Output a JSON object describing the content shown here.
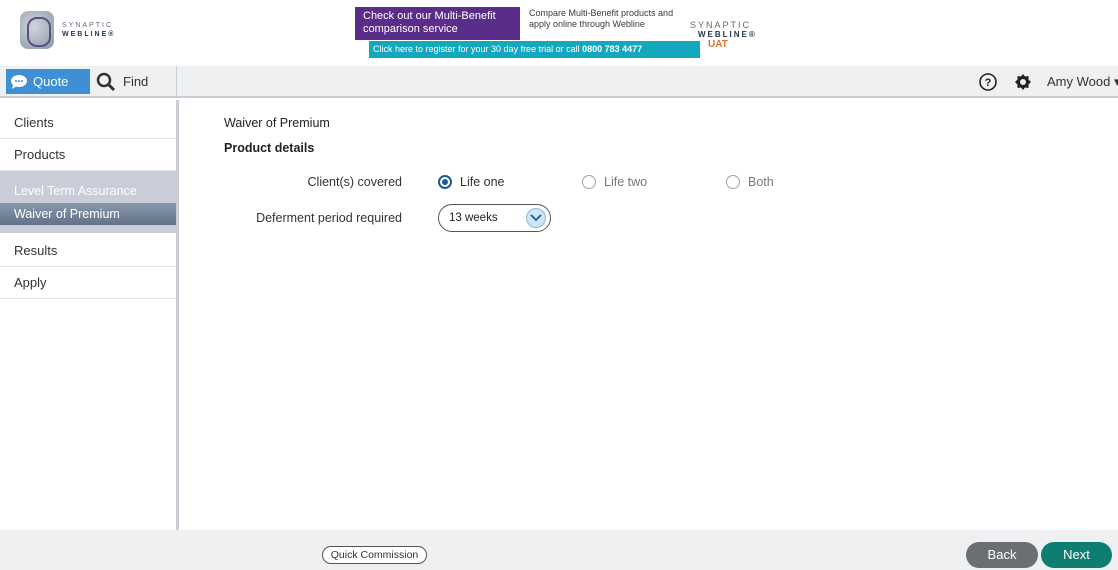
{
  "header": {
    "logo": {
      "line1": "SYNAPTIC",
      "line2": "WEBLINE®"
    },
    "banner": {
      "purple_text": "Check out our Multi-Benefit comparison service",
      "white_text": "Compare Multi-Benefit products and apply online through Webline",
      "right_synaptic": "SYNAPTIC",
      "right_webline": "WEBLINE®",
      "right_env": "UAT",
      "teal_text": "Click here to register for  your 30 day free trial or call",
      "teal_phone": "0800 783 4477"
    }
  },
  "topbar": {
    "quote_label": "Quote",
    "find_label": "Find",
    "user_name": "Amy Wood ▾"
  },
  "sidebar": {
    "items": [
      {
        "label": "Clients"
      },
      {
        "label": "Products"
      },
      {
        "label": "Level Term Assurance"
      },
      {
        "label": "Waiver of Premium"
      },
      {
        "label": "Results"
      },
      {
        "label": "Apply"
      }
    ]
  },
  "main": {
    "title": "Waiver of Premium",
    "section": "Product details",
    "clients_label": "Client(s) covered",
    "options": [
      {
        "label": "Life one",
        "selected": true
      },
      {
        "label": "Life two",
        "selected": false
      },
      {
        "label": "Both",
        "selected": false
      }
    ],
    "deferment_label": "Deferment period required",
    "deferment_value": "13 weeks"
  },
  "footer": {
    "quick_commission": "Quick Commission",
    "back": "Back",
    "next": "Next"
  },
  "colors": {
    "accent_blue": "#3f8fd4",
    "next_green": "#0e7d72",
    "banner_purple": "#5b2d8a",
    "banner_teal": "#14a8bf",
    "uat_orange": "#e0762d"
  }
}
